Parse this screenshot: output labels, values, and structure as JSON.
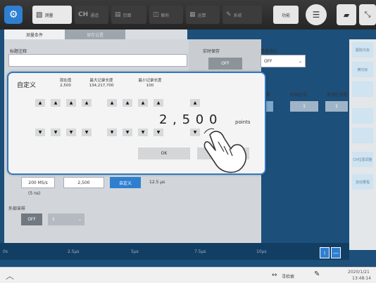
{
  "toolbar": {
    "gear_label": "⚙",
    "tabs": [
      {
        "id": "measure",
        "label": "测量",
        "icon": "waveform-icon"
      },
      {
        "id": "channel",
        "label": "CH",
        "sub": "通道"
      },
      {
        "id": "sheet",
        "label": "页面"
      },
      {
        "id": "analysis",
        "label": "解析"
      },
      {
        "id": "calc",
        "label": "运算"
      },
      {
        "id": "system",
        "label": "系统"
      }
    ],
    "func_label": "功能"
  },
  "tabs": {
    "measure_cond": "测量条件",
    "save_settings": "保存设置"
  },
  "panel": {
    "title_comment_label": "标题注释",
    "realtime_save_label": "实时保存",
    "realtime_save_value": "OFF",
    "overlay_label": "重叠描绘",
    "overlay_value": "OFF",
    "cols": [
      "数",
      "开始区块",
      "使用区块数"
    ],
    "start_block": "1",
    "use_blocks": "1",
    "sampling": "200 MS/s",
    "sampling_period": "(5 ns)",
    "record_length": "2,500",
    "custom_btn": "自定义",
    "time_val": "12.5 μs",
    "ext_sampling_label": "外部采样",
    "ext_sampling_value": "OFF",
    "ext_divide": "1"
  },
  "rside": [
    "跟踪光标",
    "横光标",
    "",
    "",
    "",
    "CH位置调整",
    "自动量程"
  ],
  "graph": {
    "ticks": [
      "0s",
      "2.5μs",
      "5μs",
      "7.5μs",
      "10μs"
    ]
  },
  "bottom": {
    "date": "2020/1/21",
    "time": "13:48:14",
    "search": "寻检索"
  },
  "dialog": {
    "title": "自定义",
    "current_label": "现在值",
    "current_value": "2,500",
    "max_label": "最大记录长度",
    "max_value": "134,217,700",
    "min_label": "最小记录长度",
    "min_value": "100",
    "value_display": "2 , 5 0 0",
    "unit": "points",
    "ok": "OK",
    "cancel": "Ca"
  }
}
